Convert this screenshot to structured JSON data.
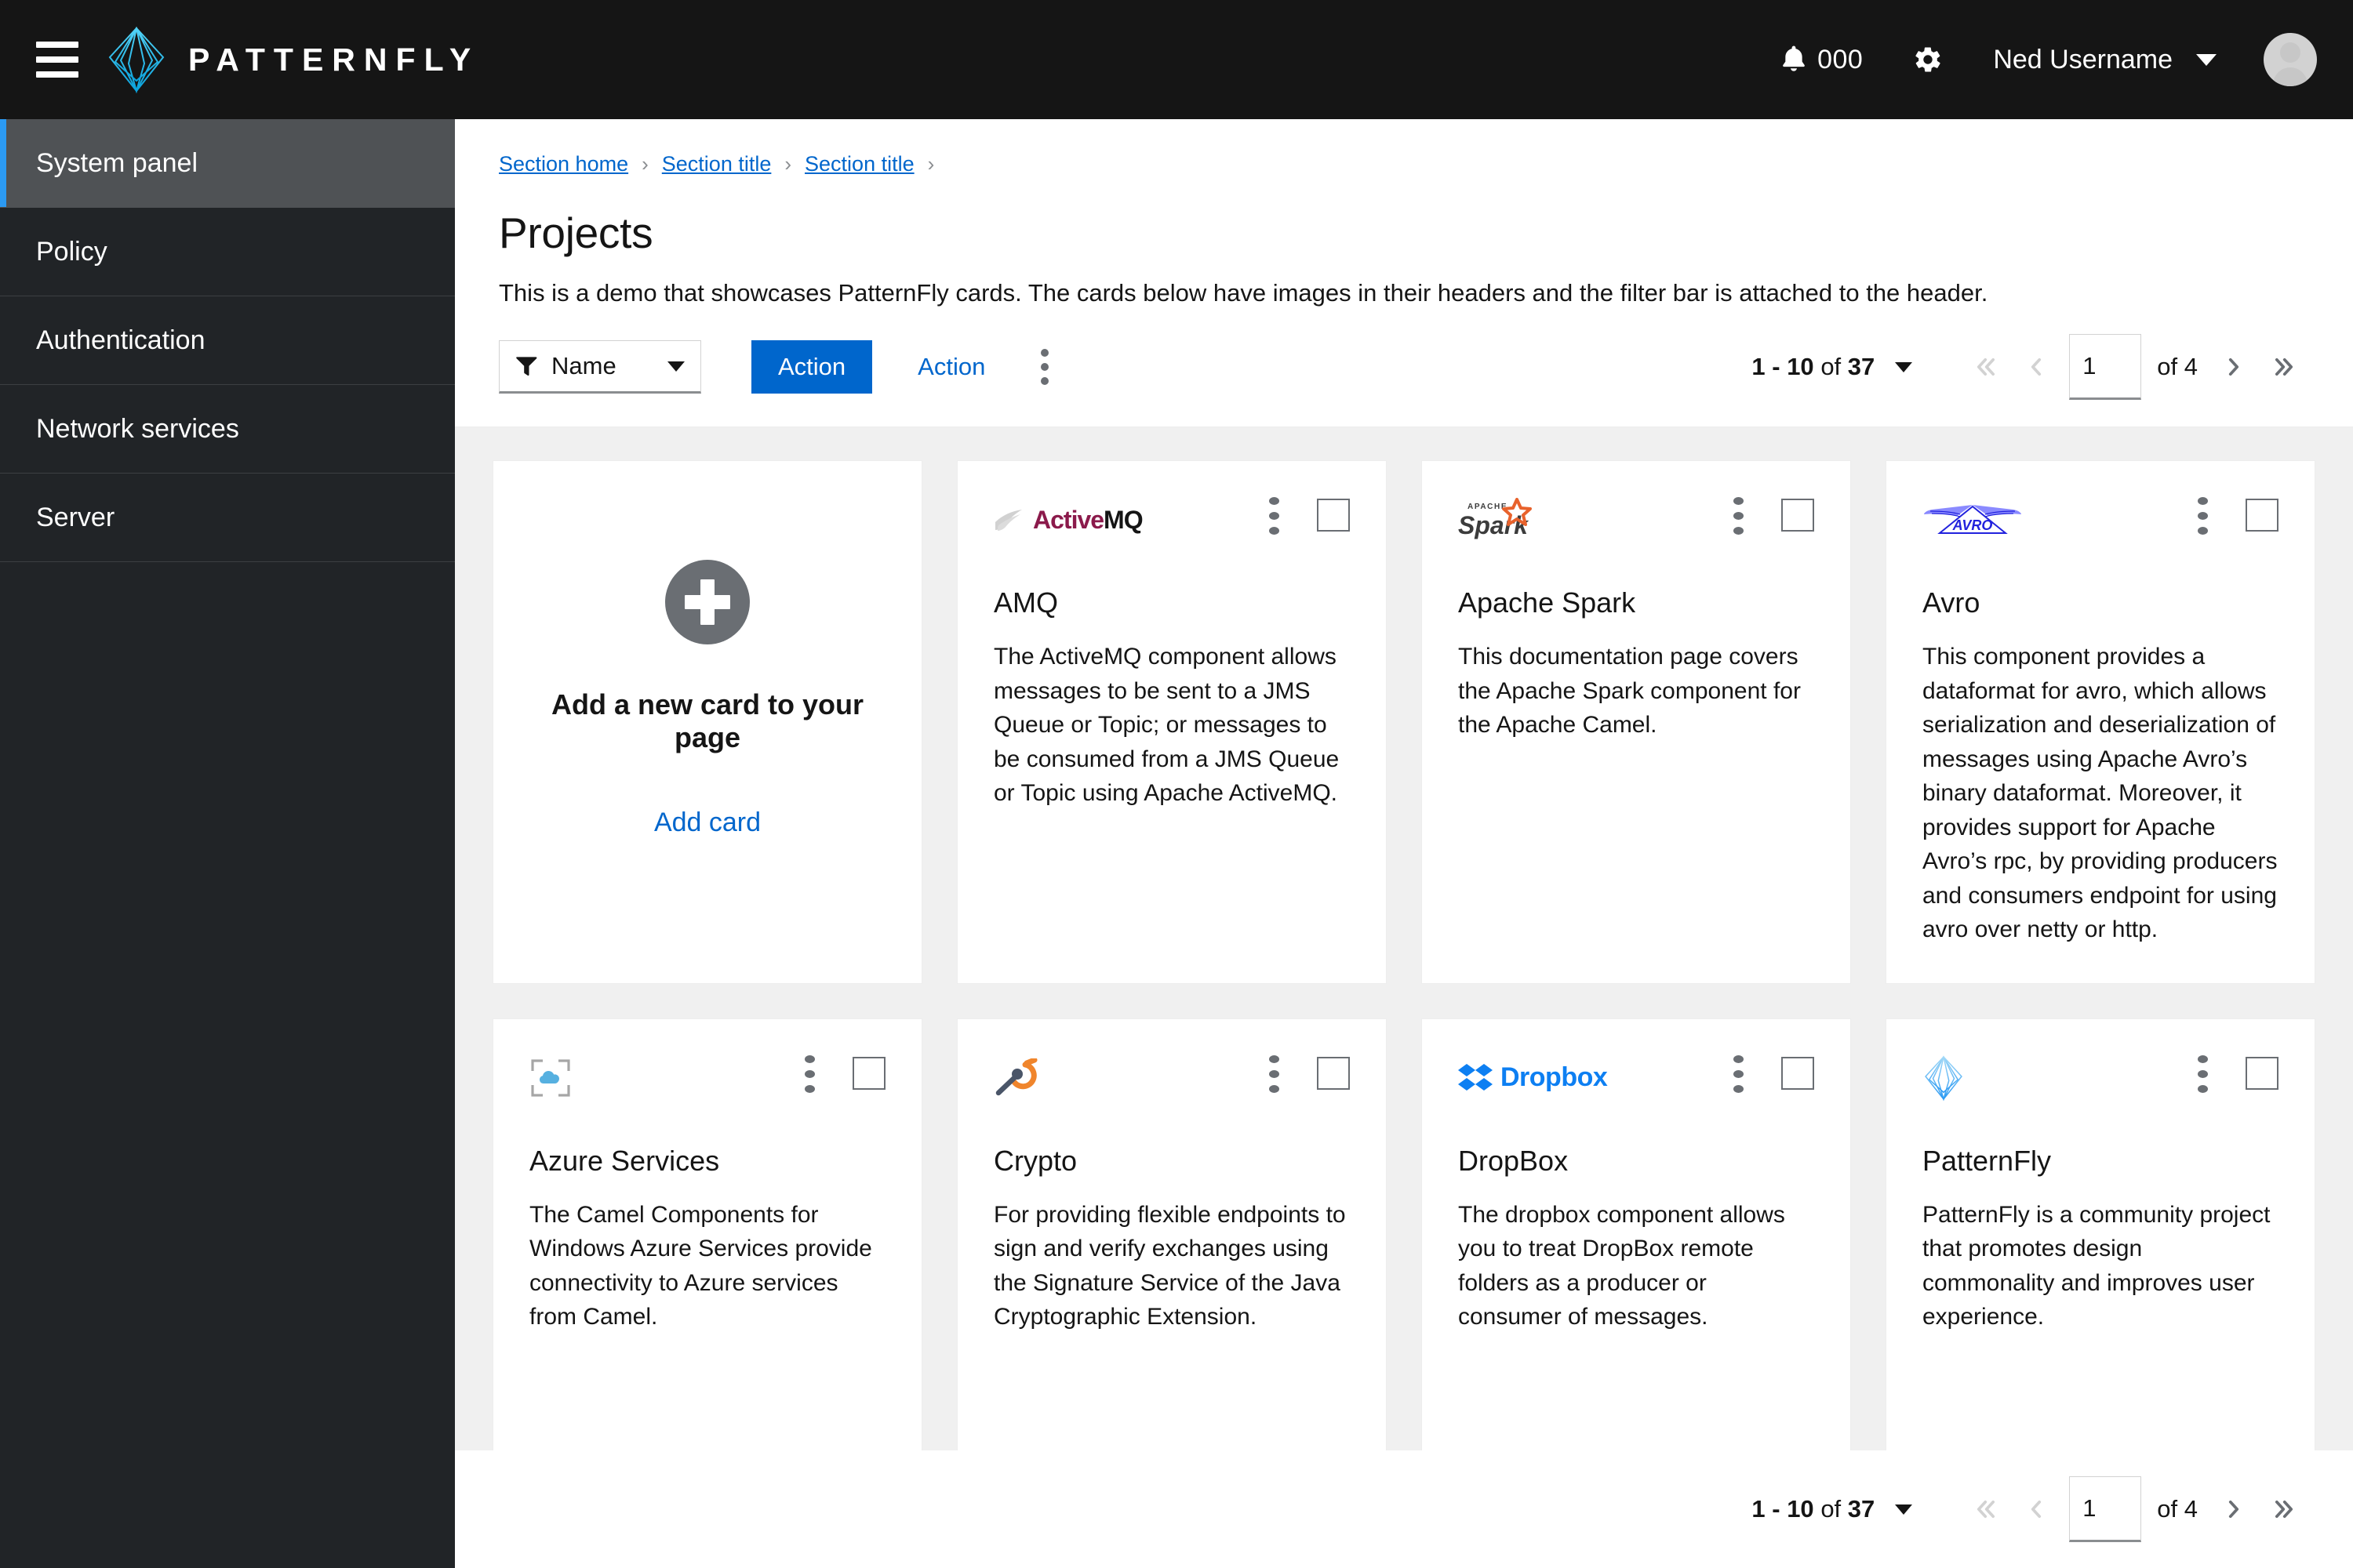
{
  "masthead": {
    "menu_icon": "hamburger-icon",
    "brand_name": "PATTERNFLY",
    "notification_icon": "bell-icon",
    "notification_count": "000",
    "settings_icon": "gear-icon",
    "username": "Ned Username",
    "avatar_icon": "user-avatar",
    "background_color": "#151515",
    "brand_accent_color": "#2bb3e8"
  },
  "sidebar": {
    "items": [
      {
        "label": "System panel",
        "active": true
      },
      {
        "label": "Policy",
        "active": false
      },
      {
        "label": "Authentication",
        "active": false
      },
      {
        "label": "Network services",
        "active": false
      },
      {
        "label": "Server",
        "active": false
      }
    ],
    "active_accent_color": "#2b9af3",
    "background_color": "#212427"
  },
  "breadcrumb": {
    "items": [
      "Section home",
      "Section title",
      "Section title"
    ],
    "separator": "›",
    "link_color": "#06c"
  },
  "page": {
    "title": "Projects",
    "description": "This is a demo that showcases PatternFly cards. The cards below have images in their headers and the filter bar is attached to the header."
  },
  "toolbar": {
    "filter": {
      "icon": "filter-icon",
      "label": "Name",
      "caret": "chevron-down-icon"
    },
    "primary_action_label": "Action",
    "secondary_action_label": "Action",
    "overflow_icon": "kebab-icon",
    "primary_color": "#06c"
  },
  "pagination": {
    "summary_range": "1 - 10",
    "summary_of": "of",
    "summary_total": "37",
    "options_caret": "chevron-down-icon",
    "first_icon": "angle-double-left-icon",
    "prev_icon": "angle-left-icon",
    "page_value": "1",
    "page_of": "of 4",
    "next_icon": "angle-right-icon",
    "last_icon": "angle-double-right-icon",
    "disabled_color": "#d2d2d2",
    "enabled_color": "#6a6e73"
  },
  "add_card": {
    "plus_icon": "plus-circle-icon",
    "title": "Add a new card to your page",
    "link_label": "Add card"
  },
  "cards": [
    {
      "logo": "activemq-logo",
      "title": "AMQ",
      "body": "The ActiveMQ component allows messages to be sent to a JMS Queue or Topic; or messages to be consumed from a JMS Queue or Topic using Apache ActiveMQ.",
      "kebab_icon": "kebab-icon",
      "checkbox_icon": "checkbox-unchecked",
      "logo_colors": [
        "#8b1a4b",
        "#151515",
        "#c9c9c9"
      ]
    },
    {
      "logo": "apache-spark-logo",
      "title": "Apache Spark",
      "body": "This documentation page covers the Apache Spark component for the Apache Camel.",
      "kebab_icon": "kebab-icon",
      "checkbox_icon": "checkbox-unchecked",
      "logo_colors": [
        "#3c3c3c",
        "#e8622c"
      ]
    },
    {
      "logo": "avro-logo",
      "title": "Avro",
      "body": "This component provides a dataformat for avro, which allows serialization and deserialization of messages using Apache Avro’s binary dataformat. Moreover, it provides support for Apache Avro’s rpc, by providing producers and consumers endpoint for using avro over netty or http.",
      "kebab_icon": "kebab-icon",
      "checkbox_icon": "checkbox-unchecked",
      "logo_colors": [
        "#2222dd",
        "#8a8aff"
      ]
    },
    {
      "logo": "azure-logo",
      "title": "Azure Services",
      "body": "The Camel Components for Windows Azure Services provide connectivity to Azure services from Camel.",
      "kebab_icon": "kebab-icon",
      "checkbox_icon": "checkbox-unchecked",
      "logo_colors": [
        "#a6a6a6",
        "#56b0e0"
      ]
    },
    {
      "logo": "crypto-logo",
      "title": "Crypto",
      "body": "For providing flexible endpoints to sign and verify exchanges using the Signature Service of the Java Cryptographic Extension.",
      "kebab_icon": "kebab-icon",
      "checkbox_icon": "checkbox-unchecked",
      "logo_colors": [
        "#f0852c",
        "#4a5568"
      ]
    },
    {
      "logo": "dropbox-logo",
      "title": "DropBox",
      "body": "The dropbox component allows you to treat DropBox remote folders as a producer or consumer of messages.",
      "kebab_icon": "kebab-icon",
      "checkbox_icon": "checkbox-unchecked",
      "logo_colors": [
        "#0d7ff2"
      ]
    },
    {
      "logo": "patternfly-logo",
      "title": "PatternFly",
      "body": "PatternFly is a community project that promotes design commonality and improves user experience.",
      "kebab_icon": "kebab-icon",
      "checkbox_icon": "checkbox-unchecked",
      "logo_colors": [
        "#73bcf7",
        "#2b9af3"
      ]
    }
  ]
}
